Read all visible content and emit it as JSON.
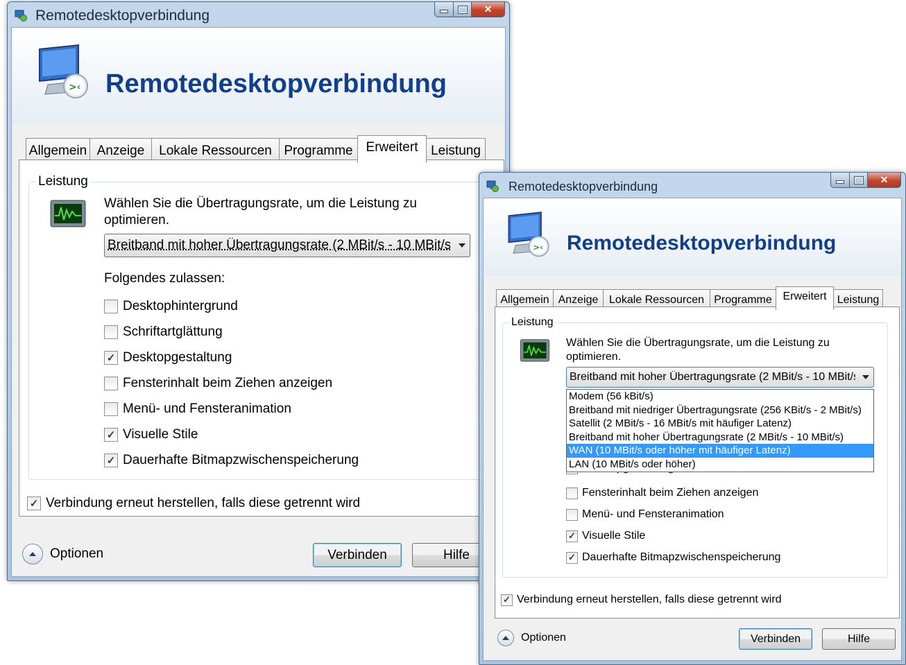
{
  "window_title": "Remotedesktopverbindung",
  "banner_title": "Remotedesktopverbindung",
  "tabs": [
    "Allgemein",
    "Anzeige",
    "Lokale Ressourcen",
    "Programme",
    "Erweitert",
    "Leistung"
  ],
  "active_tab": "Erweitert",
  "group_label": "Leistung",
  "perf_text_line1": "Wählen Sie die Übertragungsrate, um die Leistung zu",
  "perf_text_line2": "optimieren.",
  "combo_value_1": "Breitband mit hoher Übertragungsrate (2 MBit/s - 10 MBit/s",
  "combo_value_2": "Breitband mit hoher Übertragungsrate (2 MBit/s - 10 MBit/s",
  "allow_label": "Folgendes zulassen:",
  "checkboxes": [
    {
      "label": "Desktophintergrund",
      "checked": false
    },
    {
      "label": "Schriftartglättung",
      "checked": false
    },
    {
      "label": "Desktopgestaltung",
      "checked": true
    },
    {
      "label": "Fensterinhalt beim Ziehen anzeigen",
      "checked": false
    },
    {
      "label": "Menü- und Fensteranimation",
      "checked": false
    },
    {
      "label": "Visuelle Stile",
      "checked": true
    },
    {
      "label": "Dauerhafte Bitmapzwischenspeicherung",
      "checked": true
    }
  ],
  "reconnect": {
    "label": "Verbindung erneut herstellen, falls diese getrennt wird",
    "checked": true
  },
  "options_label": "Optionen",
  "connect_label": "Verbinden",
  "help_label": "Hilfe",
  "check_mark": "✓",
  "dropdown_options": [
    "Modem (56 kBit/s)",
    "Breitband mit niedriger Übertragungsrate (256 KBit/s - 2 MBit/s)",
    "Satellit (2 MBit/s - 16 MBit/s mit häufiger Latenz)",
    "Breitband mit hoher Übertragungsrate (2 MBit/s - 10 MBit/s)",
    "WAN (10 MBit/s oder höher mit häufiger Latenz)",
    "LAN (10 MBit/s oder höher)"
  ],
  "dropdown_selected_index": 4,
  "partially_hidden_checkbox": "Desktopgestaltung",
  "colors": {
    "banner_title": "#103f8e",
    "selection": "#3399ff"
  }
}
